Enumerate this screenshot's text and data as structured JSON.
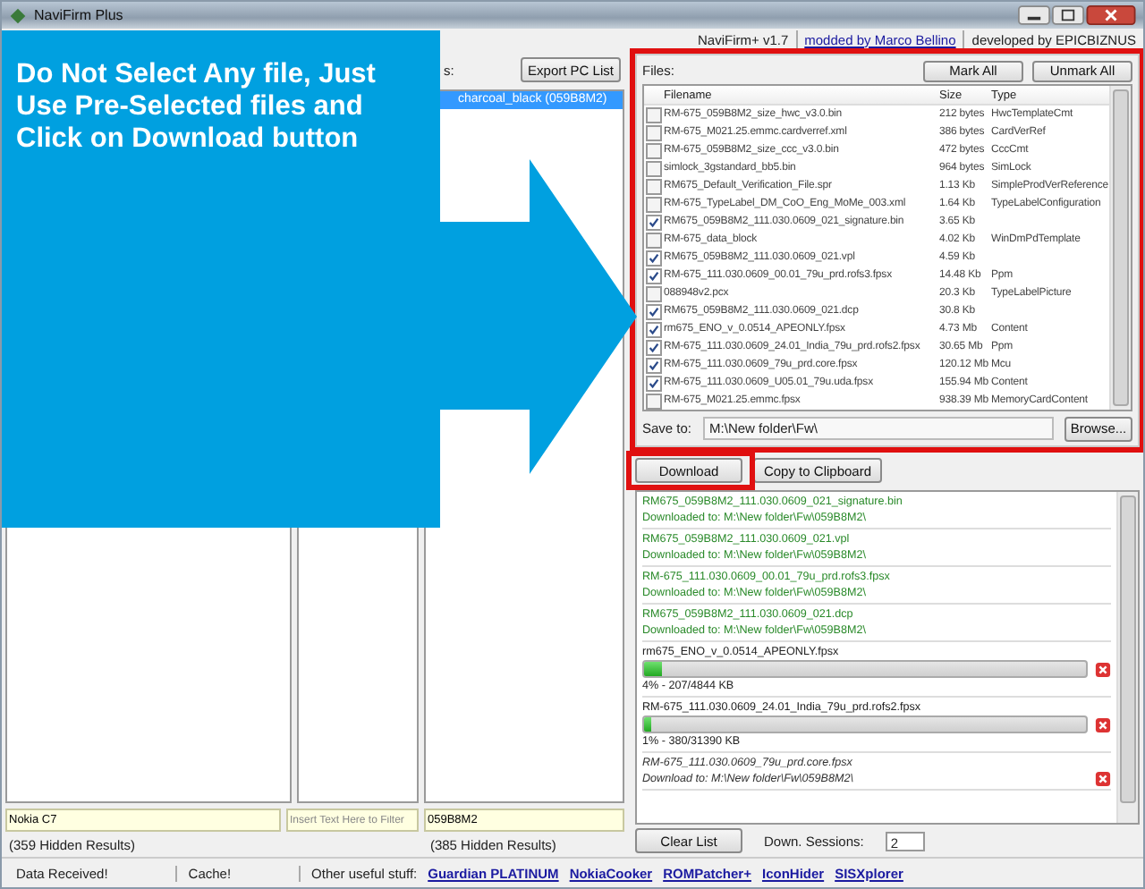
{
  "window": {
    "title": "NaviFirm Plus"
  },
  "header": {
    "version": "NaviFirm+ v1.7",
    "modded_link": "modded by Marco Bellino",
    "developer": "developed by EPICBIZNUS"
  },
  "left": {
    "label_fragment": "s:",
    "export_button": "Export PC List",
    "third_list_items": [
      {
        "text": "charcoal_black (059B8M2)",
        "selected": true
      }
    ],
    "fields": [
      {
        "value": "Nokia C7"
      },
      {
        "placeholder": "Insert Text Here to Filter"
      },
      {
        "value": "059B8M2"
      }
    ],
    "hidden_results": [
      "(359 Hidden Results)",
      "(385 Hidden Results)"
    ]
  },
  "callout": {
    "text": "Do Not Select Any file, Just Use Pre-Selected files and Click on Download button"
  },
  "files": {
    "label": "Files:",
    "mark_all": "Mark All",
    "unmark_all": "Unmark All",
    "columns": [
      "Filename",
      "Size",
      "Type"
    ],
    "rows": [
      {
        "name": "RM-675_059B8M2_size_hwc_v3.0.bin",
        "size": "212 bytes",
        "type": "HwcTemplateCmt",
        "checked": false
      },
      {
        "name": "RM-675_M021.25.emmc.cardverref.xml",
        "size": "386 bytes",
        "type": "CardVerRef",
        "checked": false
      },
      {
        "name": "RM-675_059B8M2_size_ccc_v3.0.bin",
        "size": "472 bytes",
        "type": "CccCmt",
        "checked": false
      },
      {
        "name": "simlock_3gstandard_bb5.bin",
        "size": "964 bytes",
        "type": "SimLock",
        "checked": false
      },
      {
        "name": "RM675_Default_Verification_File.spr",
        "size": "1.13 Kb",
        "type": "SimpleProdVerReference",
        "checked": false
      },
      {
        "name": "RM-675_TypeLabel_DM_CoO_Eng_MoMe_003.xml",
        "size": "1.64 Kb",
        "type": "TypeLabelConfiguration",
        "checked": false
      },
      {
        "name": "RM675_059B8M2_111.030.0609_021_signature.bin",
        "size": "3.65 Kb",
        "checked": true
      },
      {
        "name": "RM-675_data_block",
        "size": "4.02 Kb",
        "type": "WinDmPdTemplate",
        "checked": false
      },
      {
        "name": "RM675_059B8M2_111.030.0609_021.vpl",
        "size": "4.59 Kb",
        "checked": true
      },
      {
        "name": "RM-675_111.030.0609_00.01_79u_prd.rofs3.fpsx",
        "size": "14.48 Kb",
        "type": "Ppm",
        "checked": true
      },
      {
        "name": "088948v2.pcx",
        "size": "20.3 Kb",
        "type": "TypeLabelPicture",
        "checked": false
      },
      {
        "name": "RM675_059B8M2_111.030.0609_021.dcp",
        "size": "30.8 Kb",
        "checked": true
      },
      {
        "name": "rm675_ENO_v_0.0514_APEONLY.fpsx",
        "size": "4.73 Mb",
        "type": "Content",
        "checked": true
      },
      {
        "name": "RM-675_111.030.0609_24.01_India_79u_prd.rofs2.fpsx",
        "size": "30.65 Mb",
        "type": "Ppm",
        "checked": true
      },
      {
        "name": "RM-675_111.030.0609_79u_prd.core.fpsx",
        "size": "120.12 Mb",
        "type": "Mcu",
        "checked": true
      },
      {
        "name": "RM-675_111.030.0609_U05.01_79u.uda.fpsx",
        "size": "155.94 Mb",
        "type": "Content",
        "checked": true
      },
      {
        "name": "RM-675_M021.25.emmc.fpsx",
        "size": "938.39 Mb",
        "type": "MemoryCardContent",
        "checked": false
      }
    ],
    "save_label": "Save to:",
    "save_path": "M:\\New folder\\Fw\\",
    "browse": "Browse..."
  },
  "download_button": "Download",
  "copy_button": "Copy to Clipboard",
  "log": [
    {
      "kind": "done",
      "file": "RM675_059B8M2_111.030.0609_021_signature.bin",
      "status": "Downloaded to: M:\\New folder\\Fw\\059B8M2\\"
    },
    {
      "kind": "done",
      "file": "RM675_059B8M2_111.030.0609_021.vpl",
      "status": "Downloaded to: M:\\New folder\\Fw\\059B8M2\\"
    },
    {
      "kind": "done",
      "file": "RM-675_111.030.0609_00.01_79u_prd.rofs3.fpsx",
      "status": "Downloaded to: M:\\New folder\\Fw\\059B8M2\\"
    },
    {
      "kind": "done",
      "file": "RM675_059B8M2_111.030.0609_021.dcp",
      "status": "Downloaded to: M:\\New folder\\Fw\\059B8M2\\"
    },
    {
      "kind": "progress",
      "file": "rm675_ENO_v_0.0514_APEONLY.fpsx",
      "level": 0.04,
      "reading": "4%  -  207/4844 KB"
    },
    {
      "kind": "progress",
      "file": "RM-675_111.030.0609_24.01_India_79u_prd.rofs2.fpsx",
      "level": 0.01,
      "reading": "1%  -  380/31390 KB"
    },
    {
      "kind": "pending",
      "file": "RM-675_111.030.0609_79u_prd.core.fpsx",
      "status": "Download to: M:\\New folder\\Fw\\059B8M2\\"
    }
  ],
  "clear_button": "Clear List",
  "sessions_label": "Down. Sessions:",
  "sessions_value": "2",
  "status_bar": {
    "items": [
      "Data Received!",
      "Cache!",
      "Other useful stuff:"
    ],
    "links": [
      "Guardian PLATINUM",
      "NokiaCooker",
      "ROMPatcher+",
      "IconHider",
      "SISXplorer"
    ]
  }
}
